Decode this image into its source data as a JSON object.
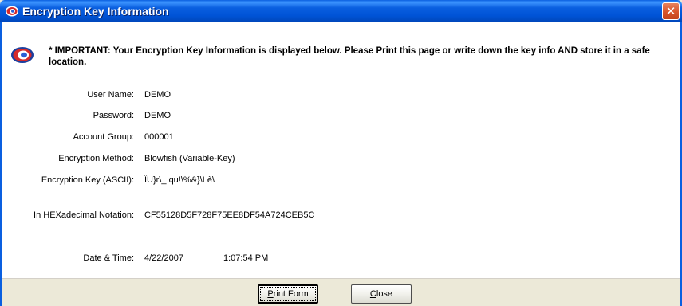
{
  "window": {
    "title": "Encryption Key Information",
    "close_glyph": "✕",
    "title_icon": "encryption-app-icon",
    "accent_color": "#0a5fe0",
    "close_color": "#d8542b"
  },
  "notice": {
    "icon": "encryption-app-icon",
    "text": "* IMPORTANT: Your Encryption Key Information is displayed below. Please Print this page or write down the key info AND store it in a safe location."
  },
  "fields": {
    "user_name": {
      "label": "User Name:",
      "value": "DEMO"
    },
    "password": {
      "label": "Password:",
      "value": "DEMO"
    },
    "account_group": {
      "label": "Account Group:",
      "value": "000001"
    },
    "encryption_method": {
      "label": "Encryption Method:",
      "value": "Blowfish (Variable-Key)"
    },
    "encryption_key_ascii": {
      "label": "Encryption Key (ASCII):",
      "value": "ÏU}r\\_ qu!\\%&}\\Lè\\"
    },
    "hex_notation": {
      "label": "In HEXadecimal Notation:",
      "value": "CF55128D5F728F75EE8DF54A724CEB5C"
    },
    "date_time": {
      "label": "Date & Time:",
      "date": "4/22/2007",
      "time": "1:07:54 PM"
    }
  },
  "buttons": {
    "print": {
      "mnemonic": "P",
      "rest": "rint Form"
    },
    "close": {
      "mnemonic": "C",
      "rest": "lose"
    }
  }
}
